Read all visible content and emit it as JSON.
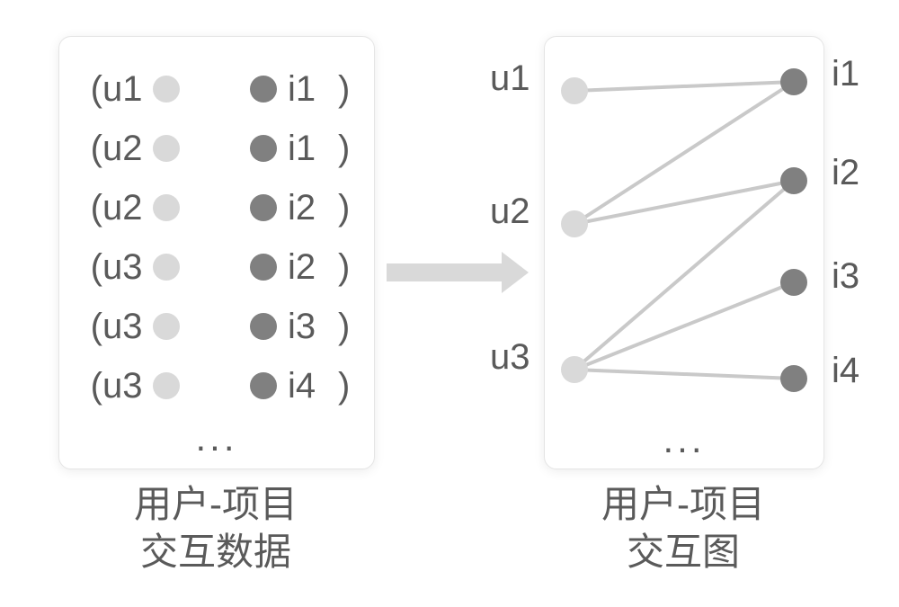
{
  "left": {
    "caption_line1": "用户-项目",
    "caption_line2": "交互数据",
    "ellipsis": "...",
    "rows": [
      {
        "u": "u1",
        "i": "i1"
      },
      {
        "u": "u2",
        "i": "i1"
      },
      {
        "u": "u2",
        "i": "i2"
      },
      {
        "u": "u3",
        "i": "i2"
      },
      {
        "u": "u3",
        "i": "i3"
      },
      {
        "u": "u3",
        "i": "i4"
      }
    ],
    "paren_open": "(",
    "paren_close": ")"
  },
  "right": {
    "caption_line1": "用户-项目",
    "caption_line2": "交互图",
    "ellipsis": "...",
    "users": [
      "u1",
      "u2",
      "u3"
    ],
    "items": [
      "i1",
      "i2",
      "i3",
      "i4"
    ],
    "edges": [
      [
        "u1",
        "i1"
      ],
      [
        "u2",
        "i1"
      ],
      [
        "u2",
        "i2"
      ],
      [
        "u3",
        "i2"
      ],
      [
        "u3",
        "i3"
      ],
      [
        "u3",
        "i4"
      ]
    ]
  },
  "colors": {
    "user_node": "#d9d9d9",
    "item_node": "#808080",
    "edge": "#c9c9c9",
    "arrow": "#d9d9d9",
    "text": "#5a5a5a"
  }
}
